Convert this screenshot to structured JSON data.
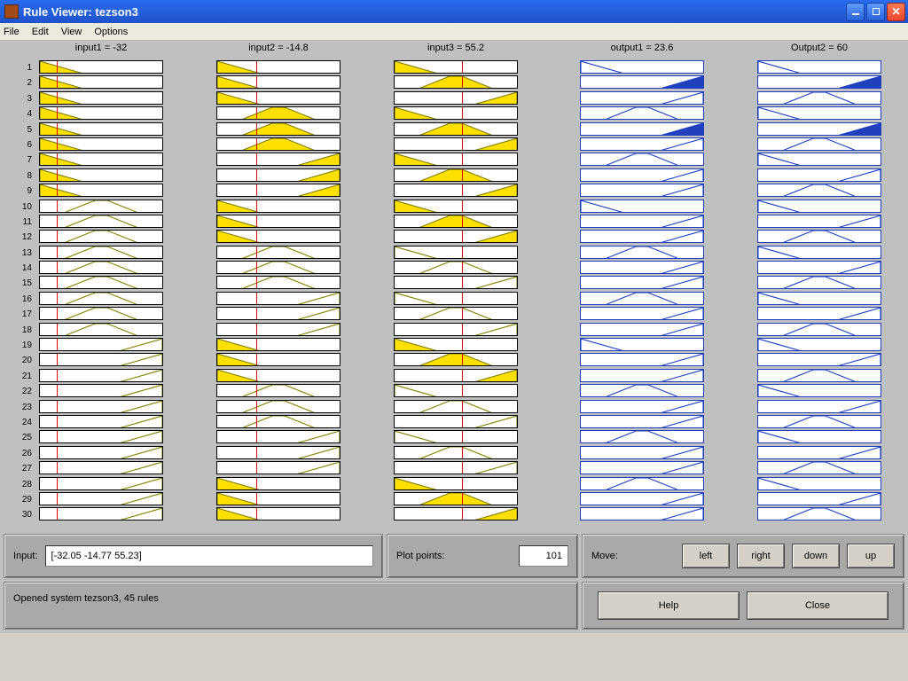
{
  "window": {
    "title": "Rule Viewer: tezson3"
  },
  "menu": {
    "file": "File",
    "edit": "Edit",
    "view": "View",
    "options": "Options"
  },
  "columns": [
    {
      "label": "input1 = -32",
      "kind": "input",
      "linePos": 0.14
    },
    {
      "label": "input2 = -14.8",
      "kind": "input",
      "linePos": 0.32
    },
    {
      "label": "input3 = 55.2",
      "kind": "input",
      "linePos": 0.55
    },
    {
      "label": "output1 = 23.6",
      "kind": "output"
    },
    {
      "label": "Output2 = 60",
      "kind": "output"
    }
  ],
  "rowCount": 30,
  "rules": {
    "input1": {
      "low": [
        1,
        2,
        3,
        4,
        5,
        6,
        7,
        8,
        9
      ],
      "mid": [
        10,
        11,
        12,
        13,
        14,
        15,
        16,
        17,
        18
      ],
      "high": [
        19,
        20,
        21,
        22,
        23,
        24,
        25,
        26,
        27,
        28,
        29,
        30
      ]
    },
    "input2": {
      "low": [
        1,
        2,
        3,
        10,
        11,
        12,
        19,
        20,
        21,
        28,
        29,
        30
      ],
      "mid": [
        4,
        5,
        6,
        13,
        14,
        15,
        22,
        23,
        24
      ],
      "high": [
        7,
        8,
        9,
        16,
        17,
        18,
        25,
        26,
        27
      ]
    },
    "input3": {
      "low": [
        1,
        4,
        7,
        10,
        13,
        16,
        19,
        22,
        25,
        28
      ],
      "mid": [
        2,
        5,
        8,
        11,
        14,
        17,
        20,
        23,
        26,
        29
      ],
      "high": [
        3,
        6,
        9,
        12,
        15,
        18,
        21,
        24,
        27,
        30
      ]
    },
    "output1": {
      "low": [
        1,
        10,
        19
      ],
      "mid": [
        4,
        7,
        13,
        16,
        22,
        25,
        28
      ],
      "high": [
        2,
        5,
        3,
        6,
        8,
        9,
        11,
        12,
        14,
        15,
        17,
        18,
        20,
        21,
        23,
        24,
        26,
        27,
        29,
        30
      ]
    },
    "output2": {
      "low": [
        1,
        4,
        7,
        10,
        13,
        16,
        19,
        22,
        25,
        28
      ],
      "mid": [
        3,
        6,
        9,
        12,
        15,
        18,
        21,
        24,
        27,
        30
      ],
      "high": [
        2,
        5,
        8,
        11,
        14,
        17,
        20,
        23,
        26,
        29
      ]
    },
    "fire": {
      "strong": [
        1,
        2,
        3,
        4,
        5,
        6,
        7,
        8,
        9
      ],
      "partial": [
        10,
        11,
        12,
        19,
        20,
        21,
        28,
        29,
        30
      ],
      "output_fill": [
        2,
        5
      ]
    }
  },
  "panels": {
    "input": {
      "label": "Input:",
      "value": "[-32.05 -14.77 55.23]"
    },
    "plot": {
      "label": "Plot points:",
      "value": "101"
    },
    "move": {
      "label": "Move:",
      "left": "left",
      "right": "right",
      "down": "down",
      "up": "up"
    },
    "status": "Opened system tezson3, 45 rules",
    "help": "Help",
    "close": "Close"
  },
  "colors": {
    "mf_fill": "#ffe000",
    "mf_stroke": "#808000",
    "out_stroke": "#2040c0",
    "out_fill": "#2040c0",
    "slider": "#e00000"
  }
}
